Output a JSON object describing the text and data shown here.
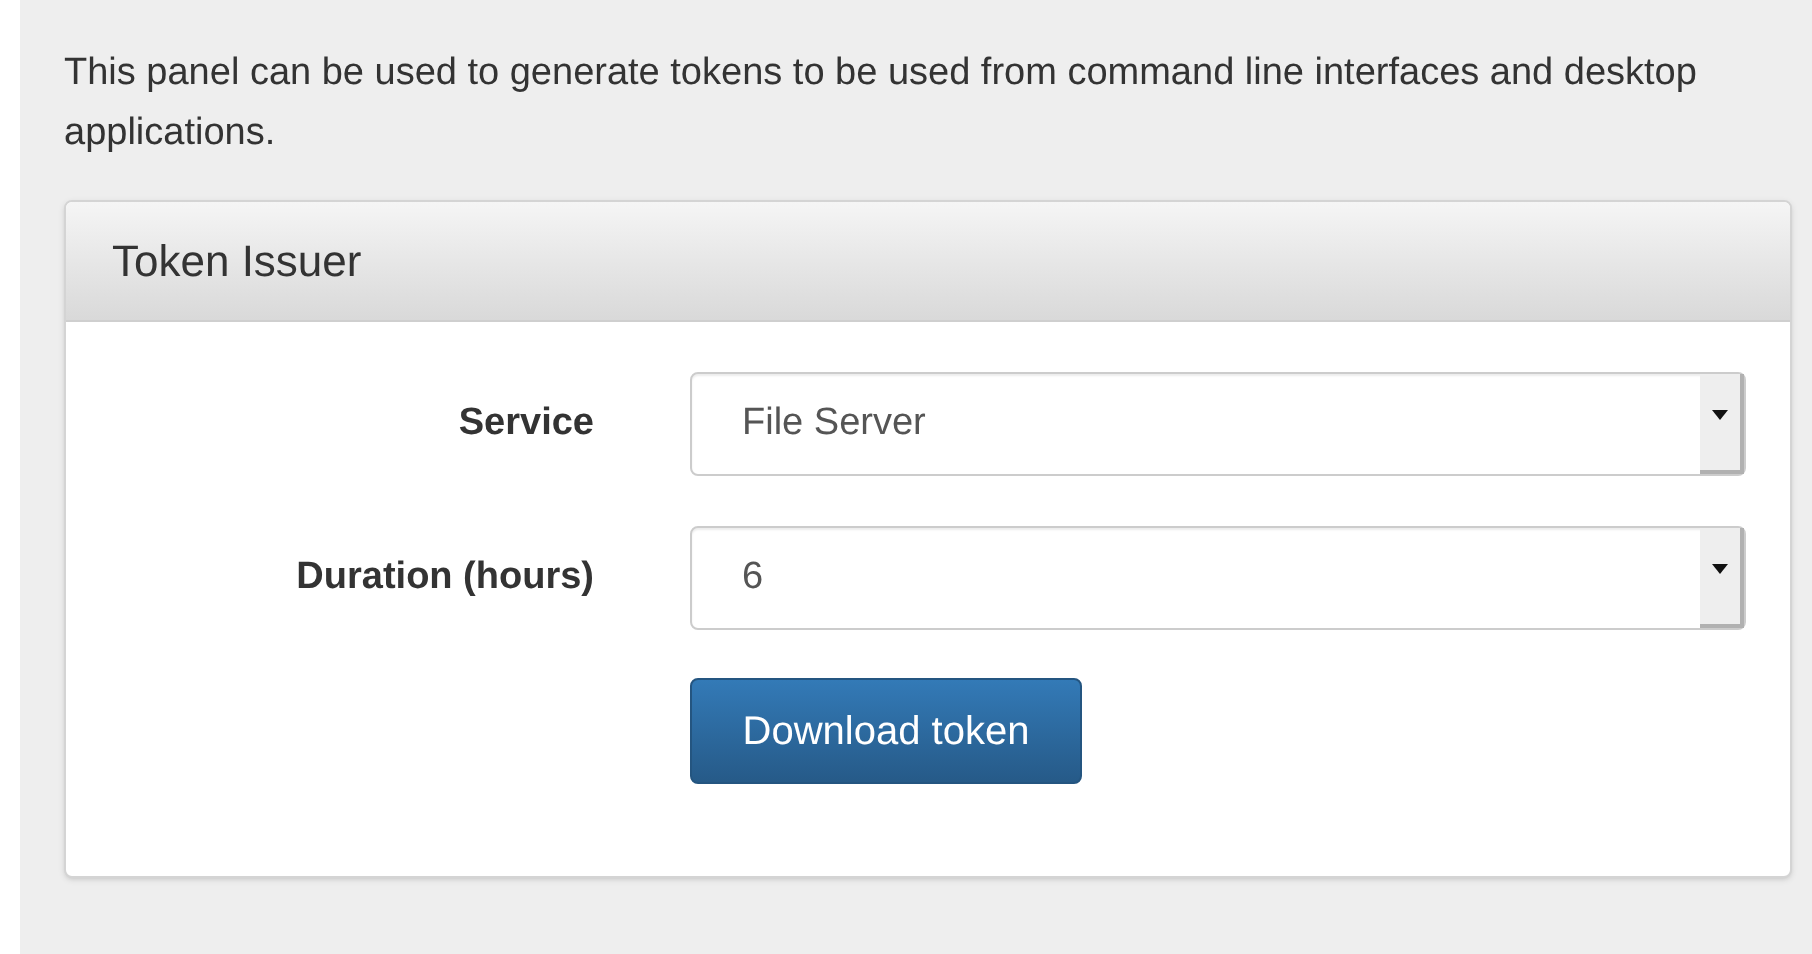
{
  "intro": "This panel can be used to generate tokens to be used from command line interfaces and desktop applications.",
  "panel": {
    "title": "Token Issuer",
    "fields": [
      {
        "label": "Service",
        "value": "File Server"
      },
      {
        "label": "Duration (hours)",
        "value": "6"
      }
    ],
    "button": "Download token"
  }
}
